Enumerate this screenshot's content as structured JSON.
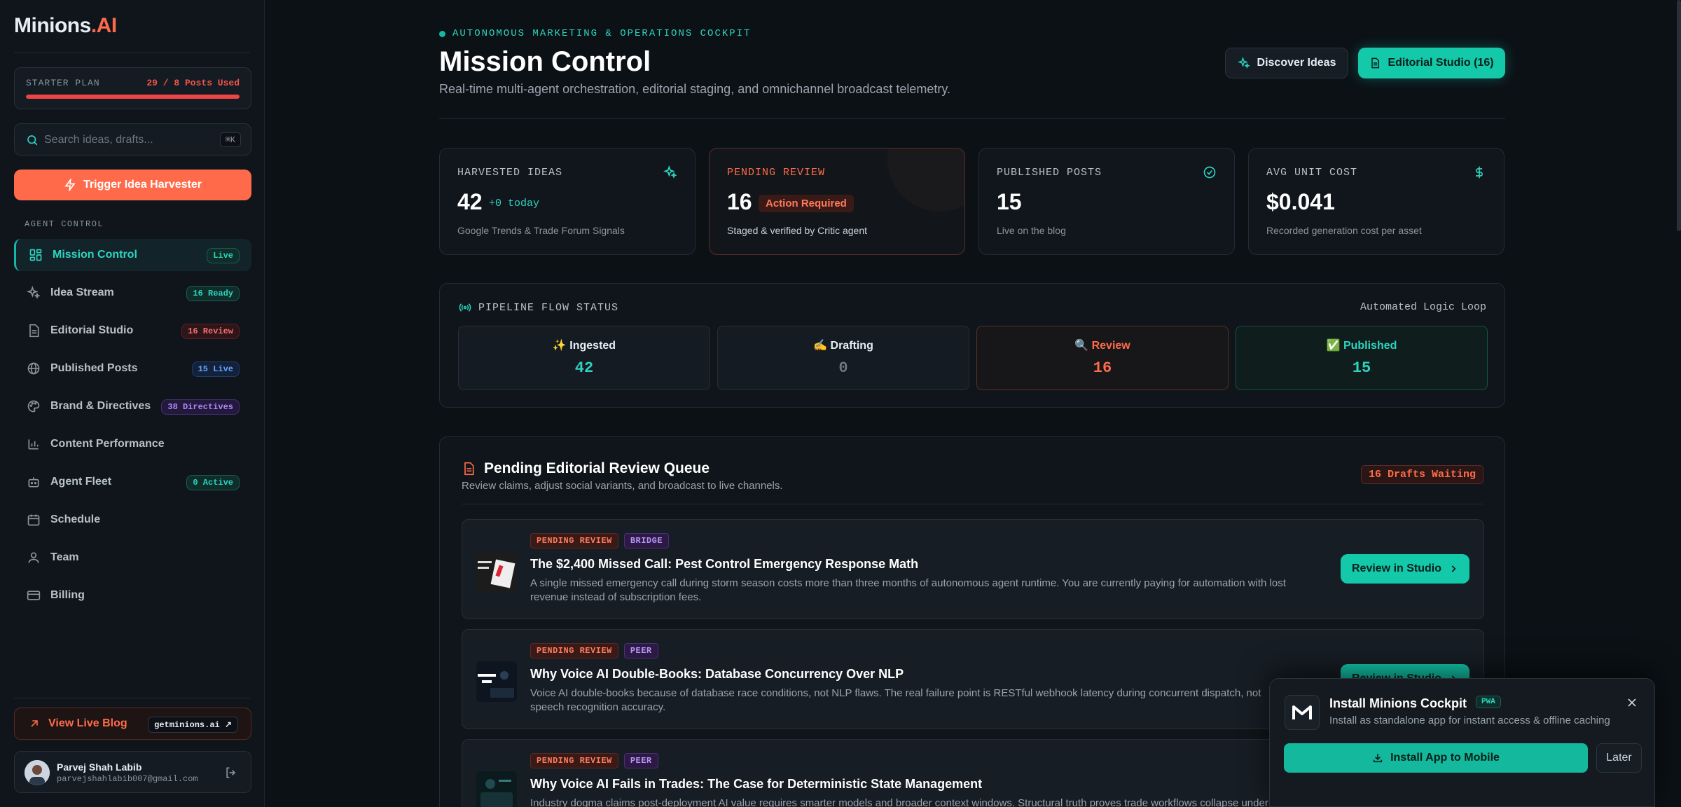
{
  "app": {
    "logo_main": "Minions",
    "logo_accent": ".AI"
  },
  "sidebar": {
    "plan_label": "STARTER PLAN",
    "plan_usage": "29 / 8 Posts Used",
    "plan_progress": 1.0,
    "search_placeholder": "Search ideas, drafts...",
    "search_shortcut": "⌘K",
    "harvest_label": "Trigger Idea Harvester",
    "section_label": "AGENT CONTROL",
    "items": [
      {
        "label": "Mission Control",
        "badge": "Live"
      },
      {
        "label": "Idea Stream",
        "badge": "16 Ready"
      },
      {
        "label": "Editorial Studio",
        "badge": "16 Review"
      },
      {
        "label": "Published Posts",
        "badge": "15 Live"
      },
      {
        "label": "Brand & Directives",
        "badge": "38 Directives"
      },
      {
        "label": "Content Performance",
        "badge": ""
      },
      {
        "label": "Agent Fleet",
        "badge": "0 Active"
      },
      {
        "label": "Schedule",
        "badge": ""
      },
      {
        "label": "Team",
        "badge": ""
      },
      {
        "label": "Billing",
        "badge": ""
      }
    ],
    "live_blog_label": "View Live Blog",
    "live_blog_domain": "getminions.ai ↗",
    "user_name": "Parvej Shah Labib",
    "user_email": "parvejshahlabib007@gmail.com"
  },
  "header": {
    "eyebrow": "AUTONOMOUS MARKETING & OPERATIONS COCKPIT",
    "title": "Mission Control",
    "subtitle": "Real-time multi-agent orchestration, editorial staging, and omnichannel broadcast telemetry.",
    "discover_label": "Discover Ideas",
    "editorial_label": "Editorial Studio (16)"
  },
  "stats": [
    {
      "label": "HARVESTED IDEAS",
      "value": "42",
      "extra": "+0 today",
      "desc": "Google Trends & Trade Forum Signals"
    },
    {
      "label": "PENDING REVIEW",
      "value": "16",
      "extra": "Action Required",
      "desc": "Staged & verified by Critic agent"
    },
    {
      "label": "PUBLISHED POSTS",
      "value": "15",
      "extra": "",
      "desc": "Live on the blog"
    },
    {
      "label": "AVG UNIT COST",
      "value": "$0.041",
      "extra": "",
      "desc": "Recorded generation cost per asset"
    }
  ],
  "pipeline": {
    "title": "PIPELINE FLOW STATUS",
    "right_label": "Automated Logic Loop",
    "stages": [
      {
        "label": "✨ Ingested",
        "value": "42",
        "color": "#2dd4bf"
      },
      {
        "label": "✍️ Drafting",
        "value": "0",
        "color": "#6e7681"
      },
      {
        "label": "🔍 Review",
        "value": "16",
        "color": "#ff6b4a"
      },
      {
        "label": "✅ Published",
        "value": "15",
        "color": "#2dd4bf"
      }
    ]
  },
  "queue": {
    "title": "Pending Editorial Review Queue",
    "subtitle": "Review claims, adjust social variants, and broadcast to live channels.",
    "badge": "16 Drafts Waiting",
    "button_label": "Review in Studio",
    "items": [
      {
        "status": "PENDING REVIEW",
        "kind": "BRIDGE",
        "title": "The $2,400 Missed Call: Pest Control Emergency Response Math",
        "body": "A single missed emergency call during storm season costs more than three months of autonomous agent runtime. You are currently paying for automation with lost revenue instead of subscription fees."
      },
      {
        "status": "PENDING REVIEW",
        "kind": "PEER",
        "title": "Why Voice AI Double-Books: Database Concurrency Over NLP",
        "body": "Voice AI double-books because of database race conditions, not NLP flaws. The real failure point is RESTful webhook latency during concurrent dispatch, not speech recognition accuracy."
      },
      {
        "status": "PENDING REVIEW",
        "kind": "PEER",
        "title": "Why Voice AI Fails in Trades: The Case for Deterministic State Management",
        "body": "Industry dogma claims post-deployment AI value requires smarter models and broader context windows. Structural truth proves trade workflows collapse under semantic"
      }
    ]
  },
  "toast": {
    "title": "Install Minions Cockpit",
    "badge": "PWA",
    "subtitle": "Install as standalone app for instant access & offline caching",
    "install_label": "Install App to Mobile",
    "later_label": "Later"
  },
  "colors": {
    "teal": "#14c8aa",
    "orange": "#ff6b4a",
    "red": "#ef4444",
    "bg": "#0c1116"
  }
}
